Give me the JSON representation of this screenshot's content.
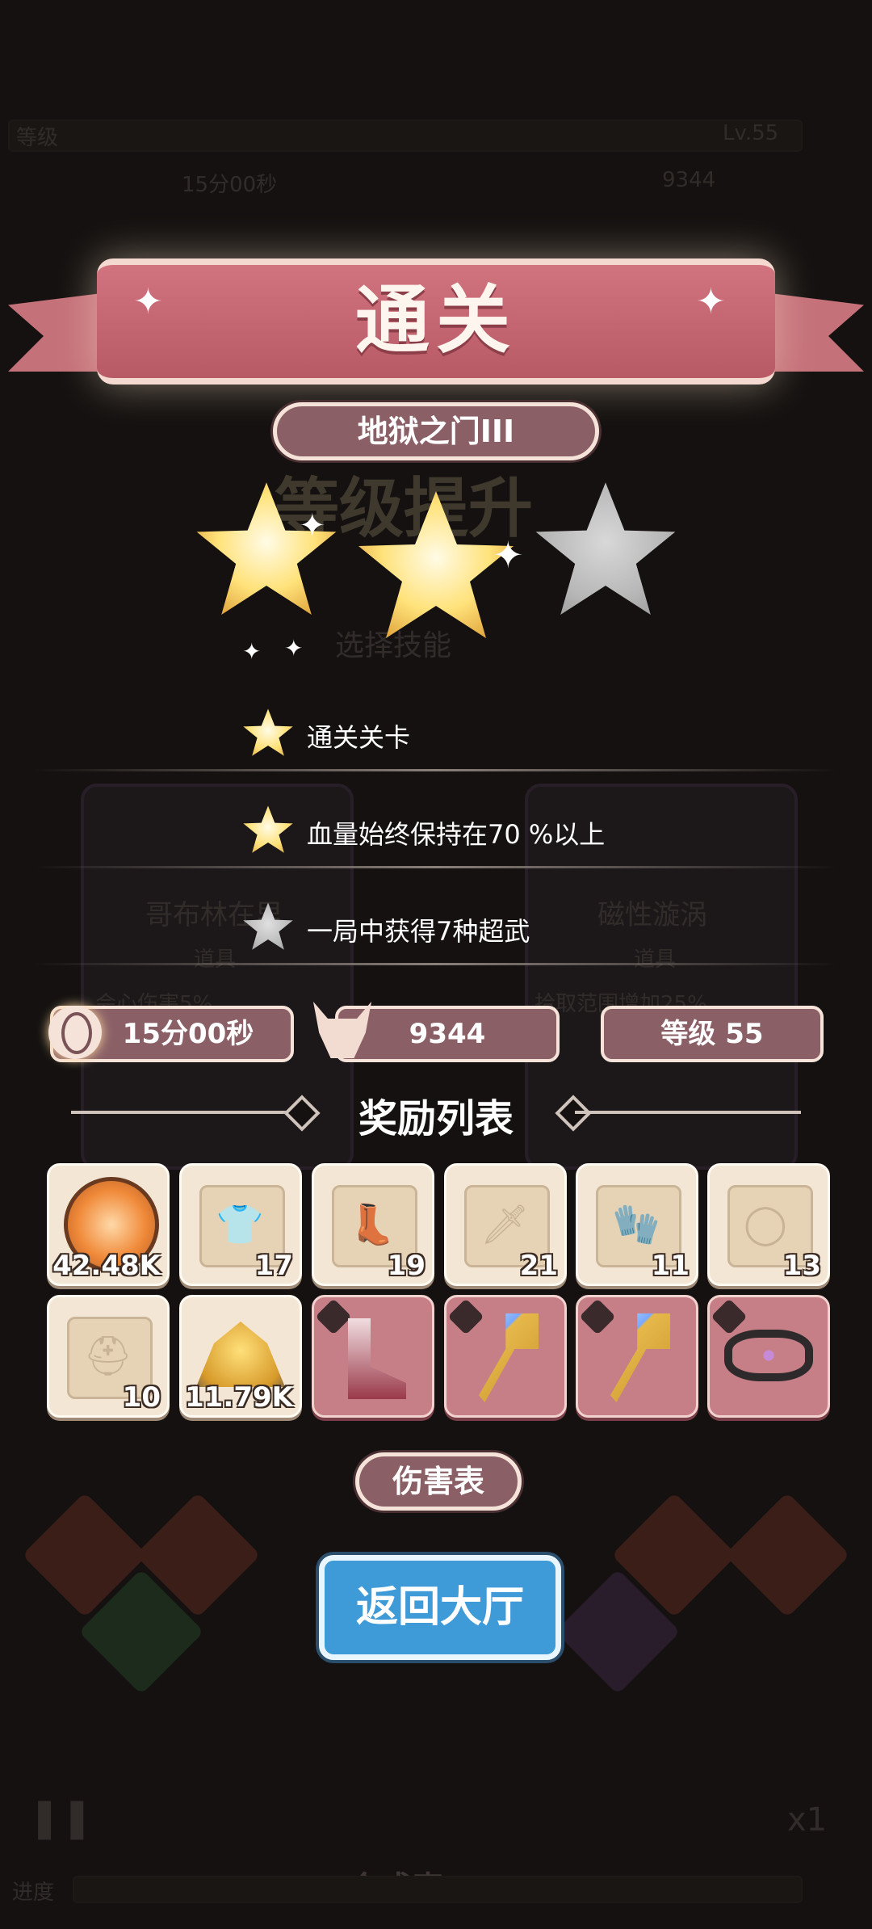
{
  "background": {
    "level_label": "等级",
    "level_value": "Lv.55",
    "timer": "15分00秒",
    "kills": "9344",
    "levelup_banner": "等级提升",
    "choose_skill": "选择技能",
    "card_left_name": "哥布林在里",
    "card_left_type": "道具",
    "card_left_desc": "会心伤害5%",
    "card_right_name": "磁性漩涡",
    "card_right_type": "道具",
    "card_right_desc": "拾取范围增加25%",
    "merge_table": "合成表",
    "progress_label": "进度",
    "speed": "x1"
  },
  "result": {
    "title": "通关",
    "stage_name": "地狱之门III",
    "stars_earned": 2,
    "stars_total": 3,
    "conditions": [
      {
        "text": "通关关卡",
        "achieved": true
      },
      {
        "text": "血量始终保持在70 %以上",
        "achieved": true
      },
      {
        "text": "一局中获得7种超武",
        "achieved": false
      }
    ],
    "time": "15分00秒",
    "kills": "9344",
    "level": "等级 55"
  },
  "rewards": {
    "title": "奖励列表",
    "items": [
      {
        "icon": "gold-coin-icon",
        "count": "42.48K",
        "rare": false
      },
      {
        "icon": "armor-scroll-icon",
        "count": "17",
        "rare": false
      },
      {
        "icon": "boots-scroll-icon",
        "count": "19",
        "rare": false
      },
      {
        "icon": "weapon-scroll-icon",
        "count": "21",
        "rare": false
      },
      {
        "icon": "glove-scroll-icon",
        "count": "11",
        "rare": false
      },
      {
        "icon": "ring-scroll-icon",
        "count": "13",
        "rare": false
      },
      {
        "icon": "helmet-scroll-icon",
        "count": "10",
        "rare": false
      },
      {
        "icon": "gold-ore-icon",
        "count": "11.79K",
        "rare": false
      },
      {
        "icon": "boots-equipment-icon",
        "count": "",
        "rare": true
      },
      {
        "icon": "scepter-equipment-icon",
        "count": "",
        "rare": true
      },
      {
        "icon": "scepter-equipment-icon",
        "count": "",
        "rare": true
      },
      {
        "icon": "belt-equipment-icon",
        "count": "",
        "rare": true
      }
    ]
  },
  "damage_table_label": "伤害表",
  "return_button": "返回大厅"
}
